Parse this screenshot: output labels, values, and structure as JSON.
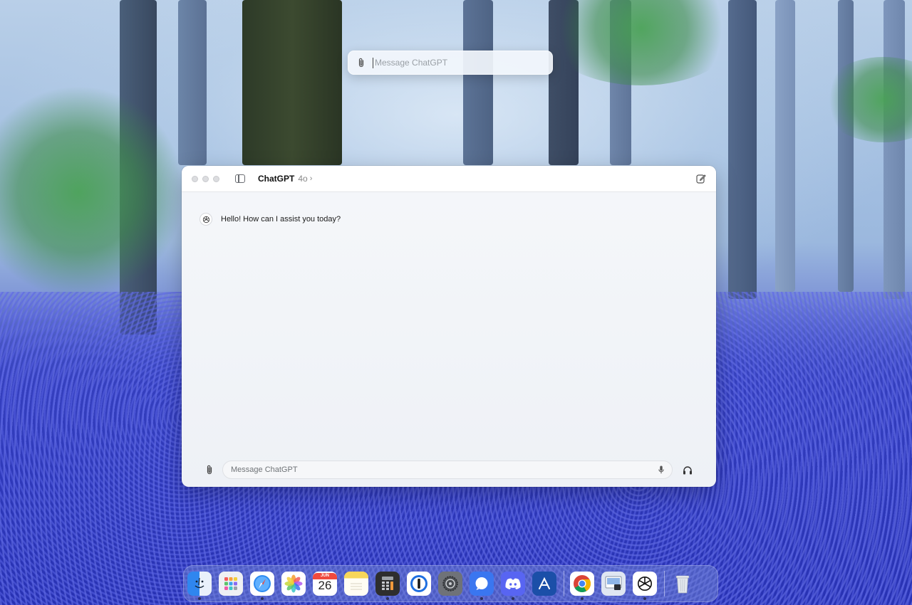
{
  "launcher": {
    "placeholder": "Message ChatGPT"
  },
  "window": {
    "app_name": "ChatGPT",
    "model": "4o",
    "model_chevron": "›"
  },
  "conversation": {
    "messages": [
      {
        "role": "assistant",
        "text": "Hello! How can I assist you today?"
      }
    ]
  },
  "composer": {
    "placeholder": "Message ChatGPT"
  },
  "calendar": {
    "month": "JUN",
    "day": "26"
  },
  "dock": {
    "items": [
      {
        "name": "finder",
        "color": "#3f8ff0"
      },
      {
        "name": "launchpad",
        "color": "#f2f2f2"
      },
      {
        "name": "safari",
        "color": "#2e8bf0"
      },
      {
        "name": "photos",
        "color": "#ffffff"
      },
      {
        "name": "calendar",
        "color": "#ffffff"
      },
      {
        "name": "notes",
        "color": "#f7d65a"
      },
      {
        "name": "calculator",
        "color": "#3a3a3a"
      },
      {
        "name": "1password",
        "color": "#1f6fe0"
      },
      {
        "name": "system-settings",
        "color": "#6f7278"
      },
      {
        "name": "signal",
        "color": "#3a76f0"
      },
      {
        "name": "discord",
        "color": "#5865f2"
      },
      {
        "name": "app-store-connect",
        "color": "#1b4fa8"
      },
      {
        "name": "chrome",
        "color": "#ffffff"
      },
      {
        "name": "preview",
        "color": "#dfe6f2"
      },
      {
        "name": "chatgpt",
        "color": "#ffffff"
      },
      {
        "name": "trash",
        "color": "#d8dde6"
      }
    ]
  }
}
